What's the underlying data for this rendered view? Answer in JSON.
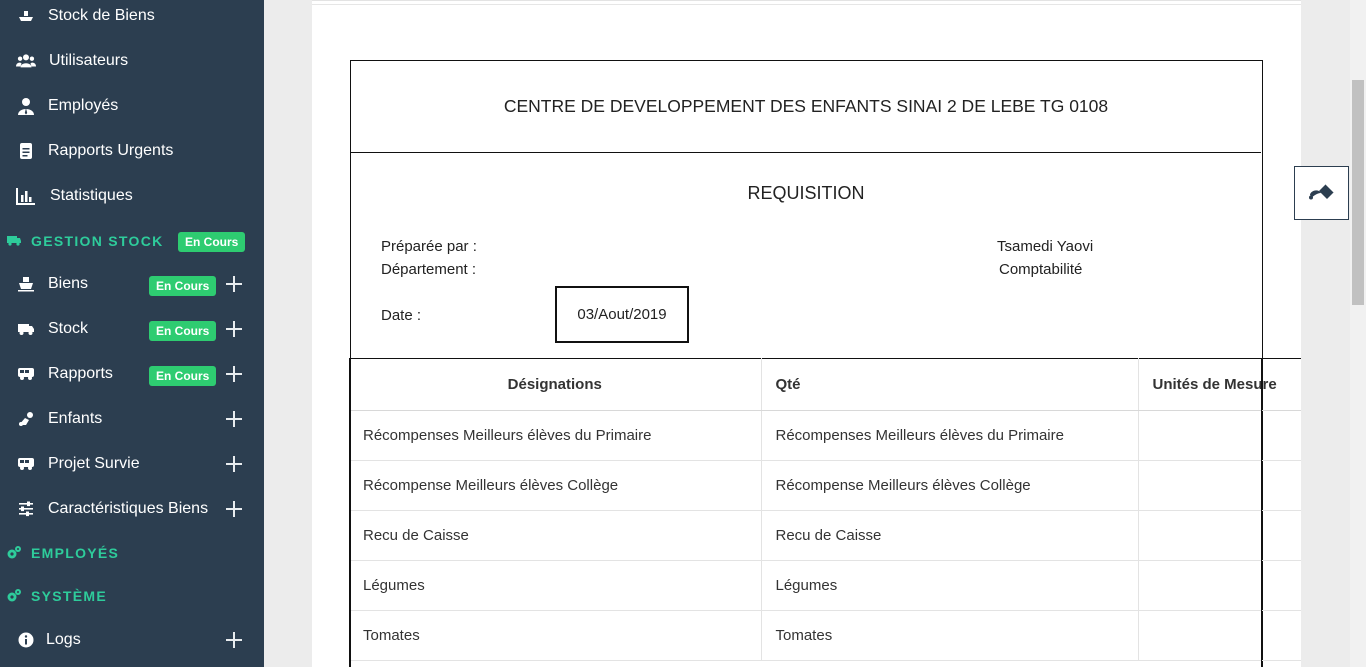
{
  "sidebar": {
    "items": [
      {
        "label": "Stock de Biens",
        "icon": "boat-icon"
      },
      {
        "label": "Utilisateurs",
        "icon": "users-icon"
      },
      {
        "label": "Employés",
        "icon": "user-tie-icon"
      },
      {
        "label": "Rapports Urgents",
        "icon": "document-icon"
      },
      {
        "label": "Statistiques",
        "icon": "bar-chart-icon"
      }
    ],
    "gestion_stock": {
      "label": "GESTION STOCK",
      "badge": "En Cours",
      "icon": "truck-icon"
    },
    "stock_items": [
      {
        "label": "Biens",
        "badge": "En Cours",
        "icon": "ship-icon"
      },
      {
        "label": "Stock",
        "badge": "En Cours",
        "icon": "truck-icon"
      },
      {
        "label": "Rapports",
        "badge": "En Cours",
        "icon": "bus-icon"
      },
      {
        "label": "Enfants",
        "icon": "child-icon"
      },
      {
        "label": "Projet Survie",
        "icon": "bus-icon"
      },
      {
        "label": "Caractéristiques Biens",
        "icon": "sliders-icon"
      }
    ],
    "employes_section": {
      "label": "EMPLOYÉS",
      "icon": "gears-icon"
    },
    "systeme_section": {
      "label": "SYSTÈME",
      "icon": "gears-icon"
    },
    "logs": {
      "label": "Logs",
      "icon": "info-icon"
    }
  },
  "document": {
    "center_name": "CENTRE DE DEVELOPPEMENT DES ENFANTS SINAI 2 DE LEBE TG 0108",
    "title": "REQUISITION",
    "prepared_by_label": "Préparée par :",
    "prepared_by_value": "Tsamedi Yaovi",
    "department_label": "Département :",
    "department_value": "Comptabilité",
    "date_label": "Date :",
    "date_value": "03/Aout/2019"
  },
  "table": {
    "headers": [
      "Désignations",
      "Qté",
      "Unités de Mesure"
    ],
    "rows": [
      [
        "Récompenses Meilleurs élèves du Primaire",
        "Récompenses Meilleurs élèves du Primaire",
        ""
      ],
      [
        "Récompense Meilleurs élèves Collège",
        "Récompense Meilleurs élèves Collège",
        ""
      ],
      [
        "Recu de Caisse",
        "Recu de Caisse",
        ""
      ],
      [
        "Légumes",
        "Légumes",
        ""
      ],
      [
        "Tomates",
        "Tomates",
        ""
      ]
    ]
  },
  "colors": {
    "sidebar_bg": "#2c3e50",
    "accent_green": "#2ecc71",
    "section_teal": "#2ecc9b"
  },
  "widgets": {
    "float_button_icon": "paint-bucket-icon"
  }
}
